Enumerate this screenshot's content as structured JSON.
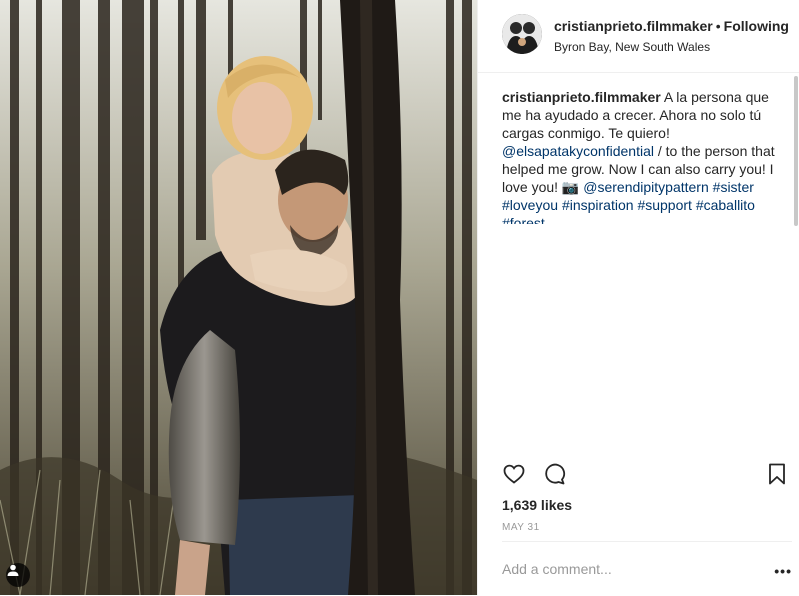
{
  "post": {
    "username": "cristianprieto.filmmaker",
    "separator": "•",
    "follow_status": "Following",
    "location": "Byron Bay, New South Wales"
  },
  "caption": {
    "username": "cristianprieto.filmmaker",
    "text_1": " A la persona que me ha ayudado a crecer. Ahora no solo tú cargas conmigo. Te quiero! ",
    "mention_1": "@elsapatakyconfidential",
    "text_2": " / to the person that helped me grow. Now I can also carry you! I love you! 📷 ",
    "mention_2": "@serendipitypattern",
    "hashtags": [
      "#sister",
      "#loveyou",
      "#inspiration",
      "#support",
      "#caballito",
      "#forest"
    ]
  },
  "stats": {
    "likes": "1,639 likes",
    "date": "MAY 31"
  },
  "comment": {
    "placeholder": "Add a comment...",
    "more": "•••"
  },
  "icons": {
    "like": "heart-icon",
    "comment": "comment-icon",
    "save": "bookmark-icon",
    "tag": "user-tag-icon"
  },
  "colors": {
    "link": "#003569",
    "text": "#262626",
    "muted": "#999999"
  }
}
